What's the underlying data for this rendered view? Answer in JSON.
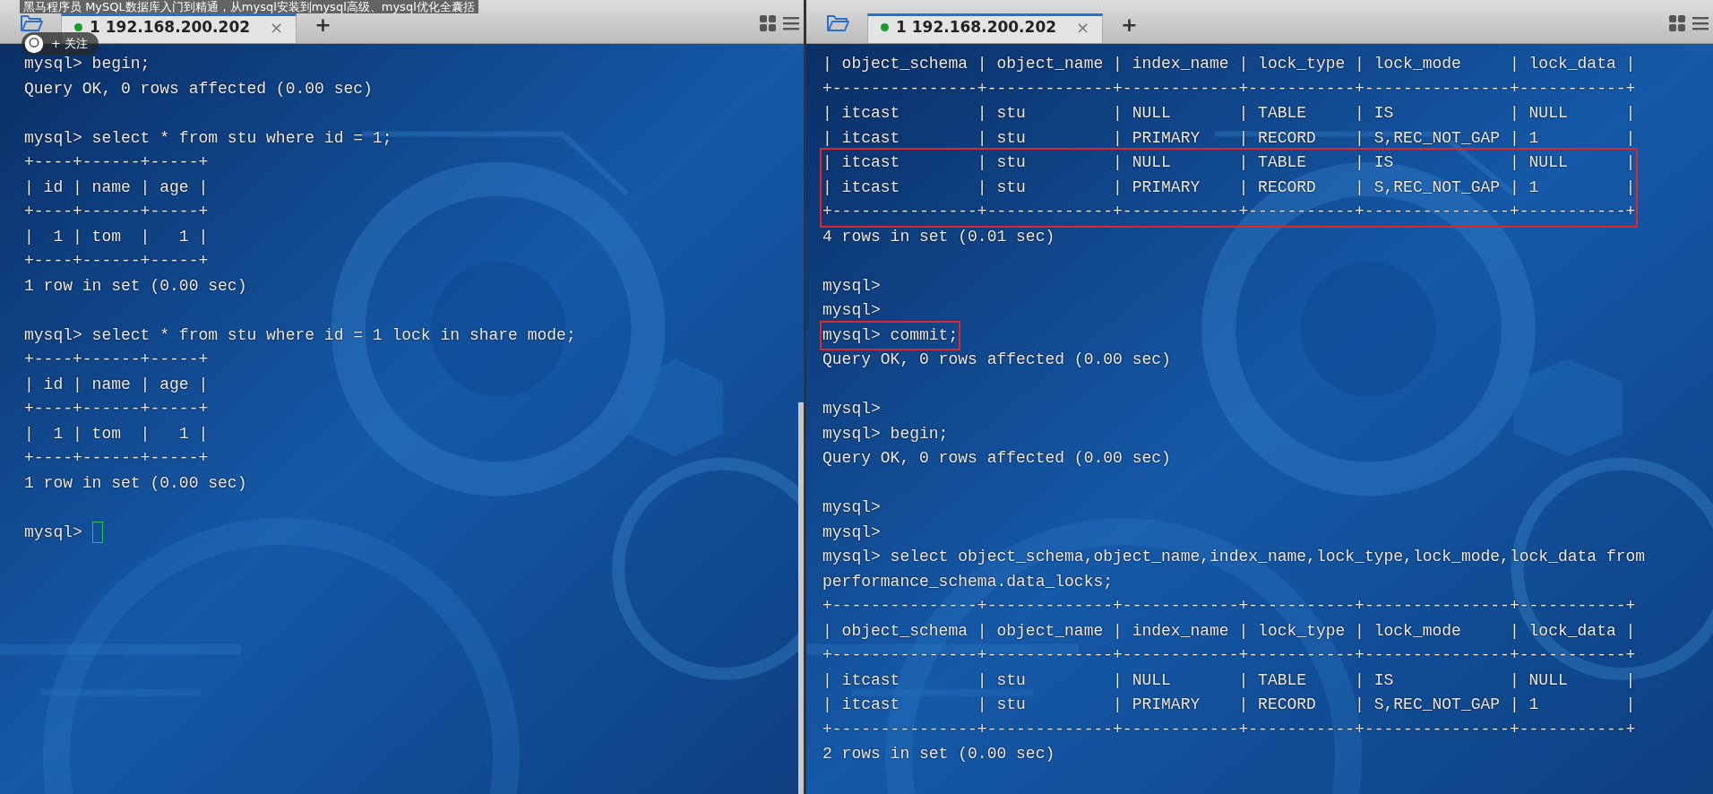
{
  "video_title": "黑马程序员 MySQL数据库入门到精通，从mysql安装到mysql高级、mysql优化全囊括",
  "follow_badge": {
    "label": "+ 关注"
  },
  "panes": [
    {
      "tab": {
        "label": "1 192.168.200.202",
        "selected": true,
        "connected": true,
        "close": "×"
      },
      "new_tab": "+",
      "scrollbar": true,
      "blocks": [
        {
          "kind": "text",
          "lines": [
            "mysql> begin;",
            "Query OK, 0 rows affected (0.00 sec)"
          ]
        },
        {
          "kind": "gap"
        },
        {
          "kind": "text",
          "lines": [
            "mysql> select * from stu where id = 1;",
            "+----+------+-----+",
            "| id | name | age |",
            "+----+------+-----+",
            "|  1 | tom  |   1 |",
            "+----+------+-----+",
            "1 row in set (0.00 sec)"
          ]
        },
        {
          "kind": "gap"
        },
        {
          "kind": "text",
          "lines": [
            "mysql> select * from stu where id = 1 lock in share mode;",
            "+----+------+-----+",
            "| id | name | age |",
            "+----+------+-----+",
            "|  1 | tom  |   1 |",
            "+----+------+-----+",
            "1 row in set (0.00 sec)"
          ]
        },
        {
          "kind": "gap"
        },
        {
          "kind": "cursor",
          "lines": [
            "mysql>"
          ]
        }
      ]
    },
    {
      "tab": {
        "label": "1 192.168.200.202",
        "selected": true,
        "connected": true,
        "close": "×"
      },
      "new_tab": "+",
      "scrollbar": false,
      "blocks": [
        {
          "kind": "text",
          "lines": [
            "| object_schema | object_name | index_name | lock_type | lock_mode     | lock_data |",
            "+---------------+-------------+------------+-----------+---------------+-----------+",
            "| itcast        | stu         | NULL       | TABLE     | IS            | NULL      |",
            "| itcast        | stu         | PRIMARY    | RECORD    | S,REC_NOT_GAP | 1         |"
          ]
        },
        {
          "kind": "boxed",
          "lines": [
            "| itcast        | stu         | NULL       | TABLE     | IS            | NULL      |",
            "| itcast        | stu         | PRIMARY    | RECORD    | S,REC_NOT_GAP | 1         |",
            "+---------------+-------------+------------+-----------+---------------+-----------+"
          ]
        },
        {
          "kind": "text",
          "lines": [
            "4 rows in set (0.01 sec)"
          ]
        },
        {
          "kind": "gap"
        },
        {
          "kind": "text",
          "lines": [
            "mysql>",
            "mysql>"
          ]
        },
        {
          "kind": "boxed",
          "lines": [
            "mysql> commit;"
          ]
        },
        {
          "kind": "text",
          "lines": [
            "Query OK, 0 rows affected (0.00 sec)"
          ]
        },
        {
          "kind": "gap"
        },
        {
          "kind": "text",
          "lines": [
            "mysql>",
            "mysql> begin;",
            "Query OK, 0 rows affected (0.00 sec)"
          ]
        },
        {
          "kind": "gap"
        },
        {
          "kind": "text",
          "lines": [
            "mysql>",
            "mysql>",
            "mysql> select object_schema,object_name,index_name,lock_type,lock_mode,lock_data from",
            "performance_schema.data_locks;",
            "+---------------+-------------+------------+-----------+---------------+-----------+",
            "| object_schema | object_name | index_name | lock_type | lock_mode     | lock_data |",
            "+---------------+-------------+------------+-----------+---------------+-----------+",
            "| itcast        | stu         | NULL       | TABLE     | IS            | NULL      |",
            "| itcast        | stu         | PRIMARY    | RECORD    | S,REC_NOT_GAP | 1         |",
            "+---------------+-------------+------------+-----------+---------------+-----------+",
            "2 rows in set (0.00 sec)"
          ]
        }
      ]
    }
  ]
}
